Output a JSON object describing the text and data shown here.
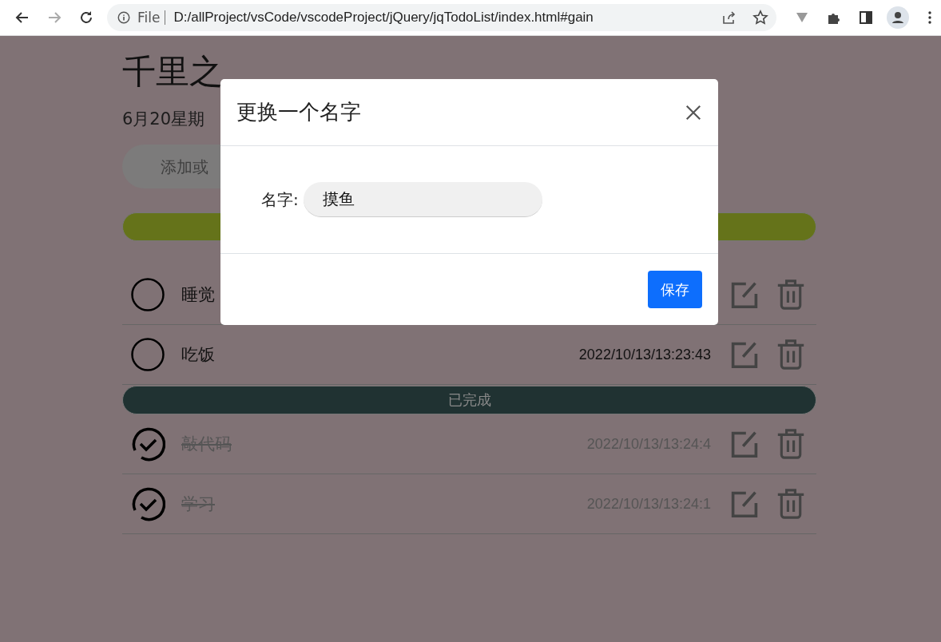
{
  "browser": {
    "scheme_label": "File",
    "url": "D:/allProject/vsCode/vscodeProject/jQuery/jqTodoList/index.html#gain"
  },
  "page": {
    "title": "千里之",
    "date": "6月20星期",
    "add_placeholder": "添加或",
    "sections": [
      {
        "color": "#65731a",
        "items": [
          {
            "text": "睡觉",
            "done": false
          },
          {
            "text": "吃饭",
            "time": "2022/10/13/13:23:43",
            "done": false
          }
        ]
      },
      {
        "label": "已完成",
        "color": "#203232",
        "items": [
          {
            "text": "敲代码",
            "time": "2022/10/13/13:24:4",
            "done": true
          },
          {
            "text": "学习",
            "time": "2022/10/13/13:24:1",
            "done": true
          }
        ]
      }
    ]
  },
  "modal": {
    "title": "更换一个名字",
    "field_label": "名字:",
    "field_value": "摸鱼",
    "save_button": "保存"
  }
}
